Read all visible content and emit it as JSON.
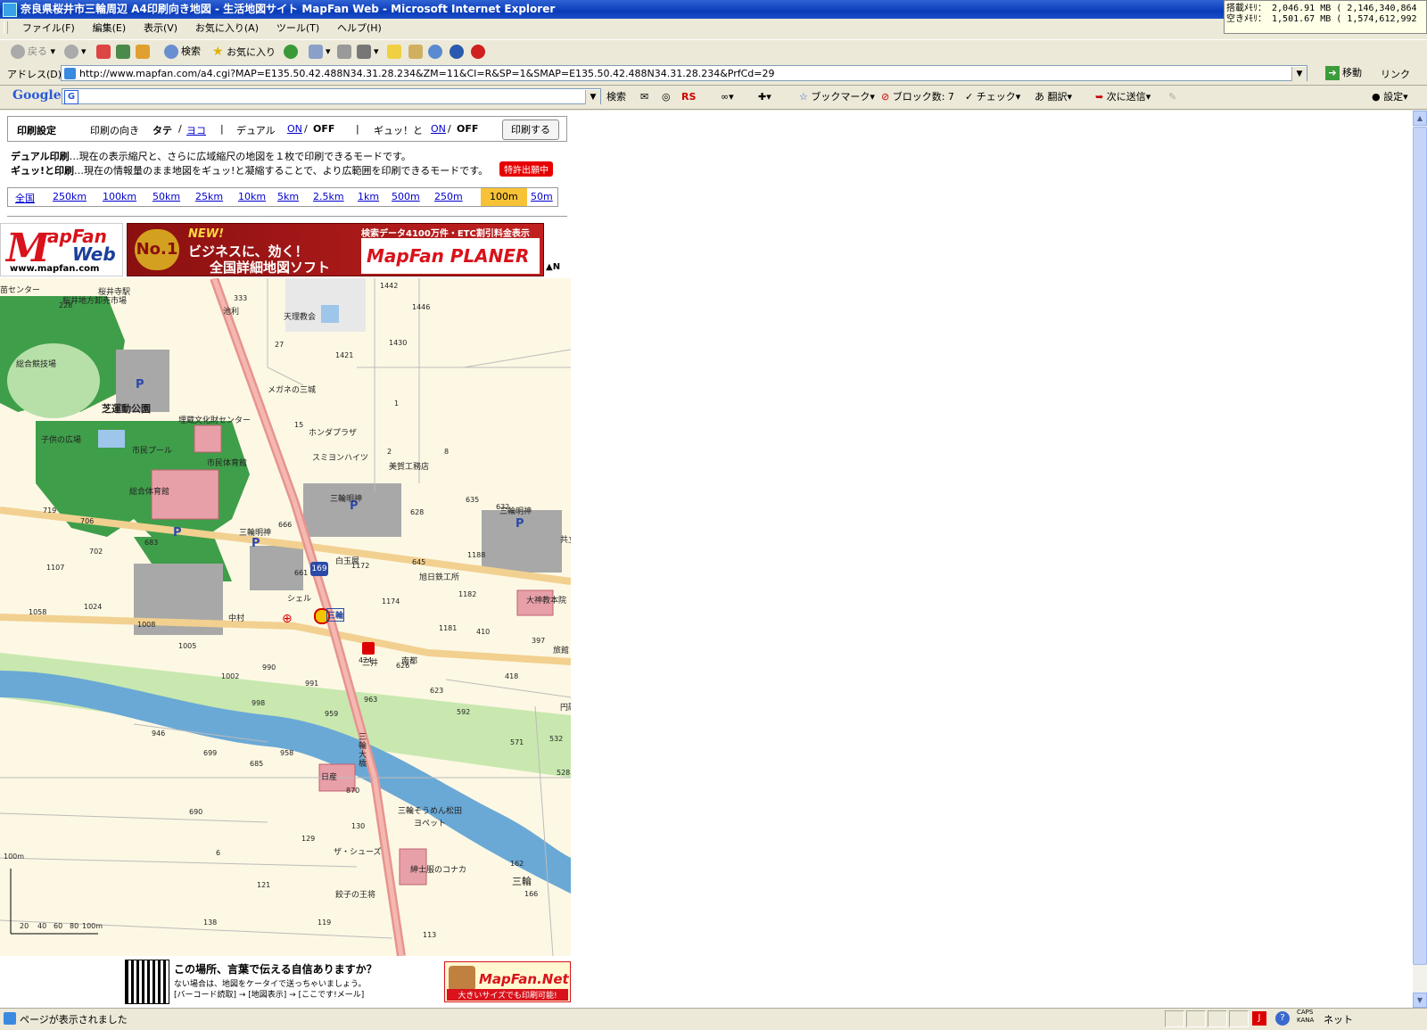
{
  "window": {
    "title": "奈良県桜井市三輪周辺 A4印刷向き地図 - 生活地図サイト MapFan Web - Microsoft Internet Explorer"
  },
  "memory": {
    "line1": "搭載ﾒﾓﾘ： 2,046.91 MB ( 2,146,340,864",
    "line2": "空きﾒﾓﾘ： 1,501.67 MB ( 1,574,612,992"
  },
  "menu": [
    "ファイル(F)",
    "編集(E)",
    "表示(V)",
    "お気に入り(A)",
    "ツール(T)",
    "ヘルプ(H)"
  ],
  "toolbar": {
    "back": "戻る",
    "search": "検索",
    "favorites": "お気に入り"
  },
  "address": {
    "label": "アドレス(D)",
    "url": "http://www.mapfan.com/a4.cgi?MAP=E135.50.42.488N34.31.28.234&ZM=11&CI=R&SP=1&SMAP=E135.50.42.488N34.31.28.234&PrfCd=29",
    "go": "移動",
    "links": "リンク"
  },
  "google_bar": {
    "logo": "Google",
    "search_btn": "検索",
    "rs": "RS",
    "bookmarks": "ブックマーク",
    "blocked": "ブロック数: 7",
    "check": "チェック",
    "translate": "翻訳",
    "send": "次に送信",
    "settings": "設定"
  },
  "print_panel": {
    "title": "印刷設定",
    "orientation_label": "印刷の向き",
    "tate": "タテ",
    "yoko": "ヨコ",
    "dual_label": "デュアル",
    "dual_on": "ON",
    "dual_off": "OFF",
    "gyu_label": "ギュッ！と",
    "gyu_on": "ON",
    "gyu_off": "OFF",
    "print_button": "印刷する",
    "sep1": "/",
    "sep2": "|"
  },
  "descriptions": {
    "dual_title": "デュアル印刷",
    "dual_text": "…現在の表示縮尺と、さらに広域縮尺の地図を１枚で印刷できるモードです。",
    "gyu_title": "ギュッ!と印刷",
    "gyu_text": "…現在の情報量のまま地図をギュッ!と凝縮することで、より広範囲を印刷できるモードです。",
    "badge": "特許出願中"
  },
  "scales": [
    "全国",
    "250km",
    "100km",
    "50km",
    "25km",
    "10km",
    "5km",
    "2.5km",
    "1km",
    "500m",
    "250m",
    "100m",
    "50m"
  ],
  "scale_selected": "100m",
  "banner": {
    "logo_m": "M",
    "logo_t1": "apFan",
    "logo_t2": "Web",
    "logo_url": "www.mapfan.com",
    "ad_no1": "No.1",
    "ad_new": "NEW!",
    "ad_line1": "ビジネスに、効く！",
    "ad_line2": "全国詳細地図ソフト",
    "ad_right1": "検索データ4100万件・ETC割引料金表示",
    "ad_right2": "MapFan PLANER 2",
    "north": "▲N"
  },
  "map": {
    "labels": [
      "苗センター",
      "桜井寺駅",
      "桜井地方卸売市場",
      "池利",
      "天理教会",
      "総合競技場",
      "メガネの三城",
      "芝運動公園",
      "埋蔵文化財センター",
      "ホンダプラザ",
      "子供の広場",
      "市民プール",
      "市民体育館",
      "スミヨンハイツ",
      "美賀工務店",
      "総合体育館",
      "三輪明神",
      "三輪明神",
      "三輪明神",
      "白玉屋",
      "旭日鉄工所",
      "シェル",
      "三輪",
      "大神教本院",
      "中村",
      "三井",
      "南都",
      "旅館",
      "円融",
      "三輪大橋",
      "日産",
      "三輪そうめん松田",
      "ヨペット",
      "ザ・シューズ",
      "紳士服のコナカ",
      "三輪",
      "餃子の王将",
      "共立"
    ],
    "numbers": [
      "333",
      "228",
      "1442",
      "1446",
      "27",
      "1430",
      "1421",
      "1",
      "15",
      "2",
      "8",
      "719",
      "706",
      "683",
      "702",
      "666",
      "628",
      "635",
      "632",
      "1107",
      "661",
      "645",
      "1172",
      "1188",
      "1058",
      "1024",
      "1182",
      "1174",
      "1008",
      "1005",
      "1181",
      "410",
      "397",
      "990",
      "424",
      "626",
      "1002",
      "991",
      "418",
      "623",
      "998",
      "959",
      "963",
      "592",
      "946",
      "571",
      "532",
      "699",
      "685",
      "958",
      "528",
      "870",
      "690",
      "130",
      "129",
      "6",
      "162",
      "121",
      "166",
      "138",
      "119",
      "113"
    ],
    "route": "169",
    "scale_unit": "100m",
    "scale_ticks": [
      "20",
      "40",
      "60",
      "80",
      "100m"
    ]
  },
  "footer": {
    "title": "この場所、言葉で伝える自信ありますか？",
    "line1": "ない場合は、地図をケータイで送っちゃいましょう。",
    "line2": "[バーコード読取] → [地図表示] → [ここです!メール]",
    "mapfannet": "MapFan.Net",
    "mapfannet_sub": "大きいサイズでも印刷可能!"
  },
  "status": {
    "message": "ページが表示されました",
    "caps": "CAPS",
    "kana": "KANA",
    "net": "ネット"
  }
}
